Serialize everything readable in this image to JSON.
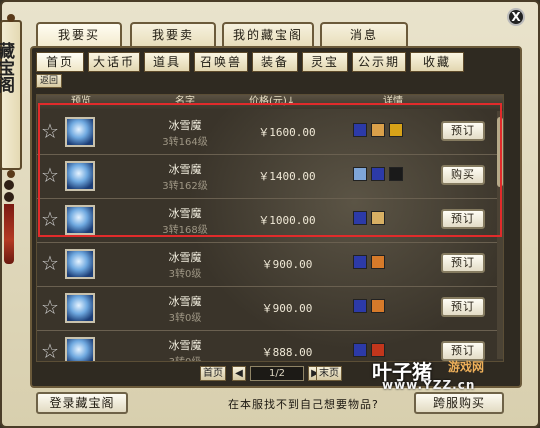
{
  "window": {
    "scroll_title": "藏宝阁",
    "close_label": "X"
  },
  "top_tabs": [
    {
      "label": "我要买",
      "active": true
    },
    {
      "label": "我要卖",
      "active": false
    },
    {
      "label": "我的藏宝阁",
      "active": false
    },
    {
      "label": "消息",
      "active": false
    }
  ],
  "category_tabs": [
    {
      "label": "首页",
      "active": true
    },
    {
      "label": "大话币",
      "active": false
    },
    {
      "label": "道具",
      "active": false
    },
    {
      "label": "召唤兽",
      "active": false
    },
    {
      "label": "装备",
      "active": false
    },
    {
      "label": "灵宝",
      "active": false
    },
    {
      "label": "公示期",
      "active": false
    },
    {
      "label": "收藏",
      "active": false
    }
  ],
  "sub_bar": {
    "back_label": "返回"
  },
  "list_headers": {
    "col1": "预览",
    "col2": "名字",
    "col3": "价格(元)↓",
    "col4": "详情"
  },
  "rows": [
    {
      "name": "冰雪魔",
      "level": "3转164级",
      "price": "￥1600.00",
      "action": "预订",
      "detail_icons": [
        "pet-stat-icon",
        "skill-ice-icon",
        "skill-gold-icon"
      ]
    },
    {
      "name": "冰雪魔",
      "level": "3转162级",
      "price": "￥1400.00",
      "action": "购买",
      "detail_icons": [
        "skill-ice-icon",
        "pet-stat-icon",
        "skill-dark-icon"
      ]
    },
    {
      "name": "冰雪魔",
      "level": "3转168级",
      "price": "￥1000.00",
      "action": "预订",
      "detail_icons": [
        "pet-stat-icon",
        "skill-gold-icon"
      ]
    },
    {
      "name": "冰雪魔",
      "level": "3转0级",
      "price": "￥900.00",
      "action": "预订",
      "detail_icons": [
        "pet-stat-icon",
        "skill-fire-icon"
      ]
    },
    {
      "name": "冰雪魔",
      "level": "3转0级",
      "price": "￥900.00",
      "action": "预订",
      "detail_icons": [
        "pet-stat-icon",
        "skill-fire-icon"
      ]
    },
    {
      "name": "冰雪魔",
      "level": "3转0级",
      "price": "￥888.00",
      "action": "预订",
      "detail_icons": [
        "pet-stat-icon",
        "skill-red-icon"
      ]
    }
  ],
  "pagination": {
    "first_label": "首页",
    "prev_label": "◀",
    "page_label": "1/2",
    "next_label": "▶",
    "last_label": "末页"
  },
  "bottom": {
    "login_label": "登录藏宝阁",
    "hint_text": "在本服找不到自己想要物品?",
    "cross_server_label": "跨服购买"
  },
  "watermark": {
    "main": "叶子猪",
    "sub": "游戏网",
    "url": "www.YZZ.cn"
  },
  "colors": {
    "highlight_border": "#e12b2b",
    "panel_bg": "#2f2a21",
    "frame_bg": "#e9e3cc"
  }
}
